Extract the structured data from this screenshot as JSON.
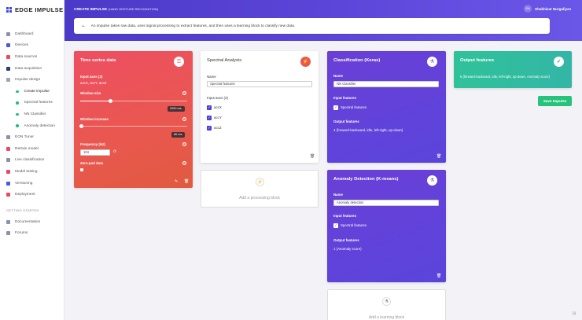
{
  "app": {
    "logo_text": "EDGE IMPULSE",
    "page_title": "CREATE IMPULSE",
    "page_subtitle": "(HAND GESTURE RECOGNITION)",
    "user_initials": "SN",
    "user_name": "Shakhizat Nurgaliyev"
  },
  "sidebar": {
    "items": [
      {
        "label": "Dashboard",
        "color": "#8a93a6"
      },
      {
        "label": "Devices",
        "color": "#4b5ad9"
      },
      {
        "label": "Data sources",
        "color": "#e84a5f"
      },
      {
        "label": "Data acquisition",
        "color": "#2c3e7a"
      },
      {
        "label": "Impulse design",
        "color": "#a0a4b0"
      }
    ],
    "sub_items": [
      {
        "label": "Create impulse"
      },
      {
        "label": "Spectral features"
      },
      {
        "label": "NN Classifier"
      },
      {
        "label": "Anomaly detection"
      }
    ],
    "items2": [
      {
        "label": "EON Tuner",
        "color": "#8a93a6"
      },
      {
        "label": "Retrain model",
        "color": "#e84a5f"
      },
      {
        "label": "Live classification",
        "color": "#8a93a6"
      },
      {
        "label": "Model testing",
        "color": "#e84a5f"
      },
      {
        "label": "Versioning",
        "color": "#4b5ad9"
      },
      {
        "label": "Deployment",
        "color": "#e84a5f"
      }
    ],
    "section_title": "GETTING STARTED",
    "items3": [
      {
        "label": "Documentation",
        "color": "#8a93a6"
      },
      {
        "label": "Forums",
        "color": "#8a93a6"
      }
    ]
  },
  "info": {
    "text": "An impulse takes raw data, uses signal processing to extract features, and then uses a learning block to classify new data."
  },
  "time_series": {
    "title": "Time series data",
    "input_axes_label": "Input axes (3)",
    "input_axes_value": "accX, accY, accZ",
    "window_size_label": "Window size",
    "window_size_value": "2000 ms.",
    "window_size_fraction": 0.28,
    "window_increase_label": "Window increase",
    "window_increase_value": "80 ms.",
    "window_increase_fraction": 0.01,
    "frequency_label": "Frequency (Hz)",
    "frequency_value": "104",
    "zero_pad_label": "Zero-pad data"
  },
  "spectral": {
    "title": "Spectral Analysis",
    "name_label": "Name",
    "name_value": "Spectral features",
    "input_axes_label": "Input axes (3)",
    "axes": [
      "accX",
      "accY",
      "accZ"
    ]
  },
  "add_processing": {
    "label": "Add a processing block"
  },
  "classification": {
    "title": "Classification (Keras)",
    "name_label": "Name",
    "name_value": "NN Classifier",
    "input_features_label": "Input features",
    "input_feature": "Spectral features",
    "output_features_label": "Output features",
    "output_features_value": "4 (forward-backward, idle, left-right, up-down)"
  },
  "anomaly": {
    "title": "Anomaly Detection (K-means)",
    "name_label": "Name",
    "name_value": "Anomaly detection",
    "input_features_label": "Input features",
    "input_feature": "Spectral features",
    "output_features_label": "Output features",
    "output_features_value": "1 (Anomaly score)"
  },
  "add_learning": {
    "label": "Add a learning block"
  },
  "output": {
    "title": "Output features",
    "value": "5 (forward-backward, idle, left-right, up-down, Anomaly score)"
  },
  "save_button": {
    "label": "Save Impulse"
  },
  "colors": {
    "time_series": "#e9584f",
    "learning_block": "#5a45dc",
    "output": "#2fc29a",
    "save": "#27c27b",
    "header": "#5b45d8"
  }
}
